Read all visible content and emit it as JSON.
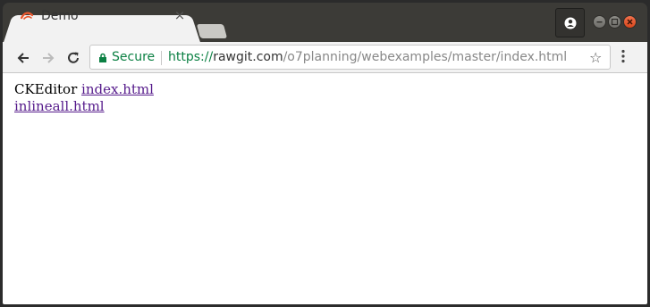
{
  "tab": {
    "title": "Demo",
    "close_label": "×"
  },
  "toolbar": {
    "secure_label": "Secure",
    "url_scheme": "https://",
    "url_host": "rawgit.com",
    "url_path": "/o7planning/webexamples/master/index.html"
  },
  "content": {
    "prefix_text": "CKEditor",
    "link1": "index.html",
    "link2": "inlineall.html"
  },
  "colors": {
    "secure_green": "#0b8043",
    "visited_link": "#551a8b"
  }
}
